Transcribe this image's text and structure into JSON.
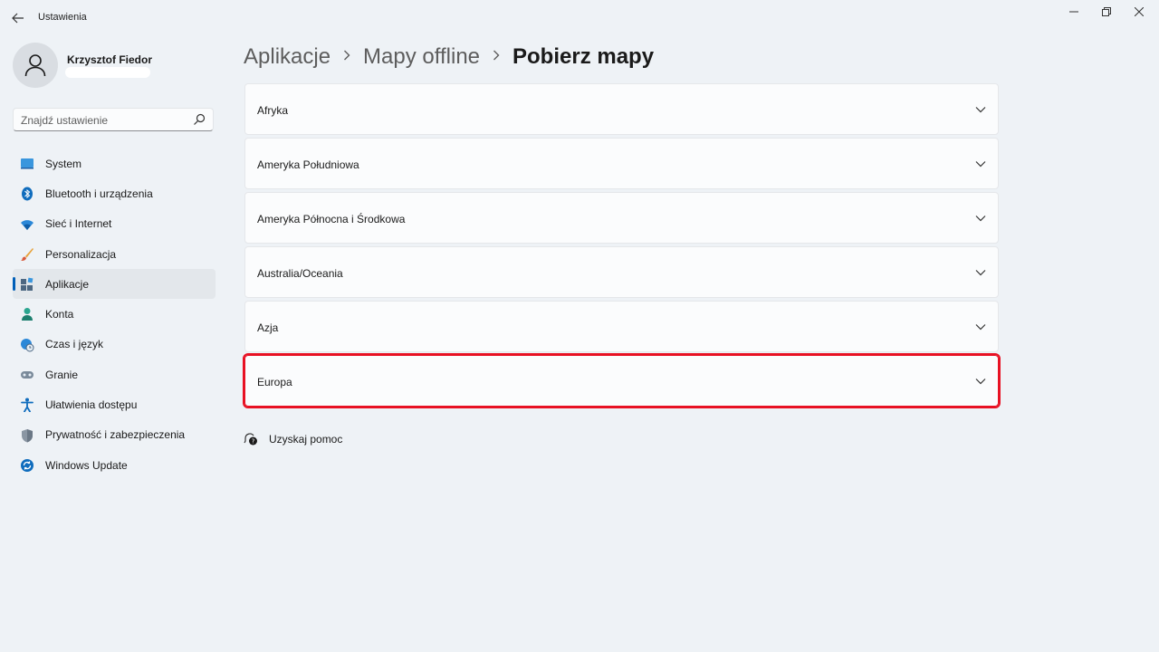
{
  "window": {
    "title": "Ustawienia"
  },
  "profile": {
    "name": "Krzysztof Fiedor"
  },
  "search": {
    "placeholder": "Znajdź ustawienie"
  },
  "sidebar": {
    "items": [
      {
        "label": "System",
        "icon": "system-icon"
      },
      {
        "label": "Bluetooth i urządzenia",
        "icon": "bluetooth-icon"
      },
      {
        "label": "Sieć i Internet",
        "icon": "wifi-icon"
      },
      {
        "label": "Personalizacja",
        "icon": "brush-icon"
      },
      {
        "label": "Aplikacje",
        "icon": "apps-icon",
        "active": true
      },
      {
        "label": "Konta",
        "icon": "account-icon"
      },
      {
        "label": "Czas i język",
        "icon": "time-language-icon"
      },
      {
        "label": "Granie",
        "icon": "gamepad-icon"
      },
      {
        "label": "Ułatwienia dostępu",
        "icon": "accessibility-icon"
      },
      {
        "label": "Prywatność i zabezpieczenia",
        "icon": "shield-icon"
      },
      {
        "label": "Windows Update",
        "icon": "update-icon"
      }
    ]
  },
  "breadcrumb": {
    "items": [
      "Aplikacje",
      "Mapy offline",
      "Pobierz mapy"
    ]
  },
  "regions": [
    {
      "label": "Afryka"
    },
    {
      "label": "Ameryka Południowa"
    },
    {
      "label": "Ameryka Północna i Środkowa"
    },
    {
      "label": "Australia/Oceania"
    },
    {
      "label": "Azja"
    },
    {
      "label": "Europa",
      "highlighted": true
    }
  ],
  "help": {
    "label": "Uzyskaj pomoc"
  },
  "colors": {
    "accent": "#005fb8",
    "highlight": "#e81123",
    "background": "#eef2f6"
  }
}
